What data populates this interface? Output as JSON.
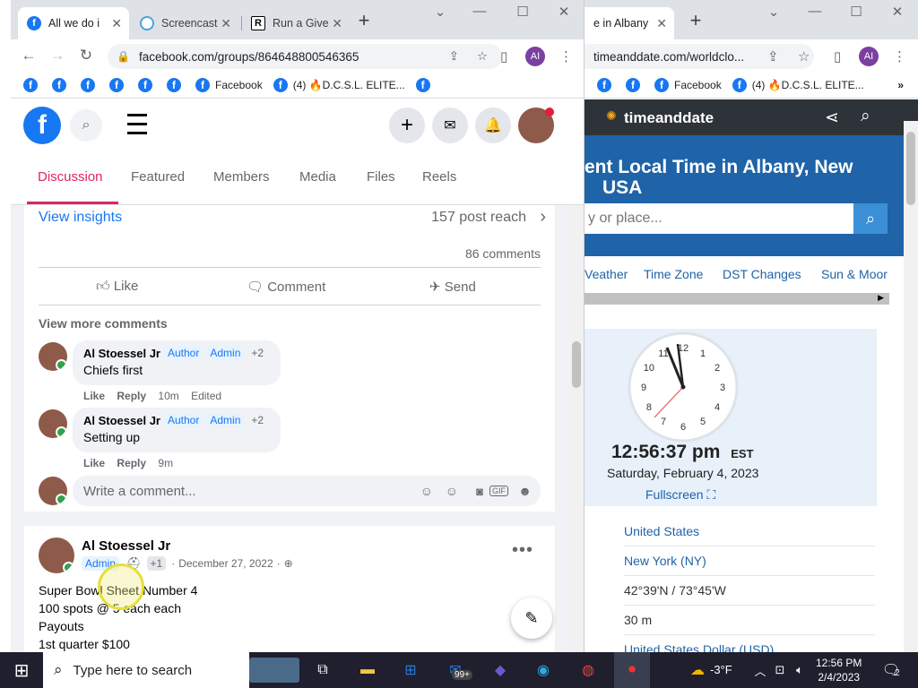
{
  "left_browser": {
    "tabs": [
      {
        "title": "All we do i",
        "favicon": "facebook-icon"
      },
      {
        "title": "Screencast",
        "favicon": "screencast-icon"
      },
      {
        "title": "Run a Give",
        "favicon": "r-icon"
      }
    ],
    "url": "facebook.com/groups/864648800546365",
    "profile_initials": "AI",
    "bookmarks": {
      "facebook_label": "Facebook",
      "dcsl_label": "(4) 🔥D.C.S.L. ELITE..."
    },
    "group_tabs": [
      "Discussion",
      "Featured",
      "Members",
      "Media",
      "Files",
      "Reels"
    ],
    "post": {
      "view_insights": "View insights",
      "post_reach": "157 post reach",
      "comments_count": "86 comments",
      "actions": {
        "like": "Like",
        "comment": "Comment",
        "send": "Send"
      },
      "view_more_comments": "View more comments",
      "comments": [
        {
          "author": "Al Stoessel Jr",
          "badge1": "Author",
          "badge2": "Admin",
          "extra": "+2",
          "text": "Chiefs first",
          "like": "Like",
          "reply": "Reply",
          "time": "10m",
          "edited": "Edited"
        },
        {
          "author": "Al Stoessel Jr",
          "badge1": "Author",
          "badge2": "Admin",
          "extra": "+2",
          "text": "Setting up",
          "like": "Like",
          "reply": "Reply",
          "time": "9m",
          "edited": ""
        }
      ],
      "write_comment_placeholder": "Write a comment..."
    },
    "post2": {
      "author": "Al Stoessel Jr",
      "badge": "Admin",
      "extra": "+1",
      "date": "December 27, 2022",
      "lines": [
        "Super Bowl Sheet Number 4",
        "100 spots @ 5 each each",
        "Payouts",
        "1st quarter $100"
      ]
    }
  },
  "right_browser": {
    "tab_title": "e in Albany",
    "url": "timeanddate.com/worldclo...",
    "profile_initials": "AI",
    "bookmarks": {
      "facebook_label": "Facebook",
      "dcsl_label": "(4) 🔥D.C.S.L. ELITE..."
    },
    "brand": "timeanddate",
    "hero_title_line1": "ent Local Time in Albany, New",
    "hero_title_line2": "USA",
    "search_placeholder": "y or place...",
    "nav": [
      "Veather",
      "Time Zone",
      "DST Changes",
      "Sun & Moor"
    ],
    "clock": {
      "time": "12:56:37 pm",
      "zone": "EST",
      "date": "Saturday, February 4, 2023",
      "fullscreen": "Fullscreen ⛶",
      "numerals": [
        "12",
        "1",
        "2",
        "3",
        "4",
        "5",
        "6",
        "7",
        "8",
        "9",
        "10",
        "11"
      ]
    },
    "rows": [
      "United States",
      "New York (NY)",
      "42°39'N / 73°45'W",
      "30 m",
      "United States Dollar (USD)"
    ]
  },
  "taskbar": {
    "search_placeholder": "Type here to search",
    "mail_badge": "99+",
    "weather": "-3°F",
    "time": "12:56 PM",
    "date": "2/4/2023",
    "notif_count": "2"
  },
  "colors": {
    "facebook_blue": "#1877f2",
    "discussion_red": "#e0245e",
    "tad_blue": "#1f63a8",
    "taskbar": "#1f1f2e"
  }
}
